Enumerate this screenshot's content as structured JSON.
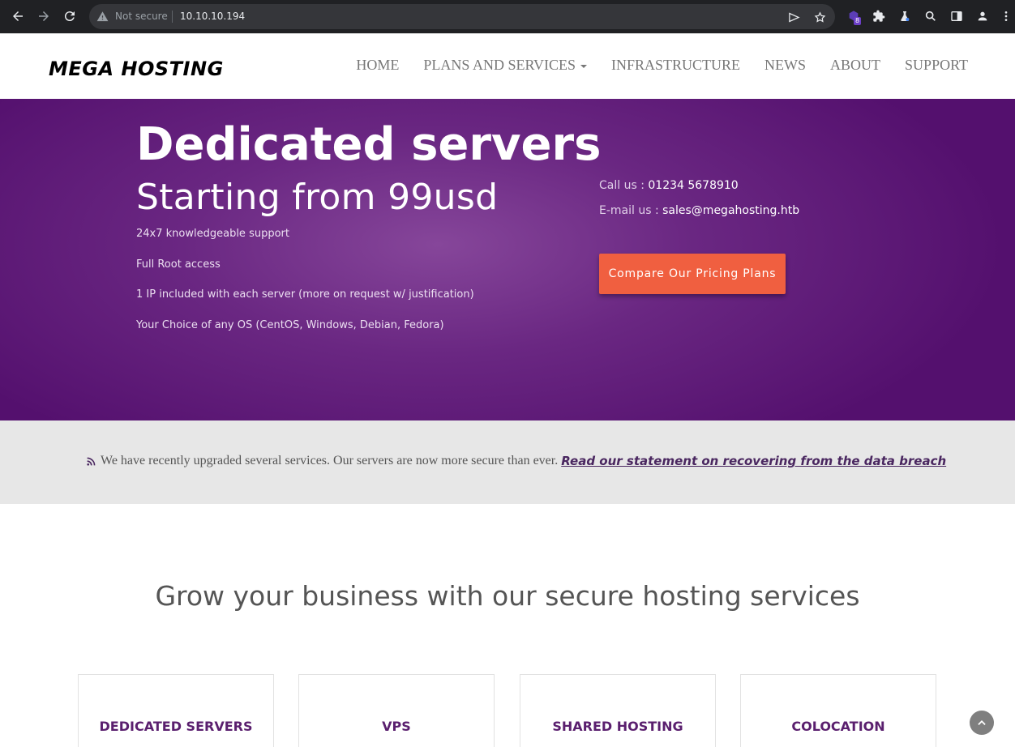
{
  "browser": {
    "security_label": "Not secure",
    "url": "10.10.10.194",
    "extension_badge": "8"
  },
  "site": {
    "logo": "MEGA HOSTING",
    "nav": [
      "HOME",
      "PLANS AND SERVICES",
      "INFRASTRUCTURE",
      "NEWS",
      "ABOUT",
      "SUPPORT"
    ]
  },
  "hero": {
    "title": "Dedicated servers",
    "subtitle": "Starting from 99usd",
    "features": [
      "24x7 knowledgeable support",
      "Full Root access",
      "1 IP included with each server (more on request w/ justification)",
      "Your Choice of any OS (CentOS, Windows, Debian, Fedora)"
    ],
    "call_label": "Call us : ",
    "call_value": "01234 5678910",
    "email_label": "E-mail us : ",
    "email_value": "sales@megahosting.htb",
    "cta": "Compare Our Pricing Plans"
  },
  "announcement": {
    "text": "We have recently upgraded several services. Our servers are now more secure than ever.",
    "link": "Read our statement on recovering from the data breach"
  },
  "services": {
    "title": "Grow your business with our secure hosting services",
    "cards": [
      "DEDICATED SERVERS",
      "VPS",
      "SHARED HOSTING",
      "COLOCATION"
    ]
  },
  "colors": {
    "hero_purple": "#6a2782",
    "cta_orange": "#f05f40",
    "card_title": "#5a1f6e"
  }
}
